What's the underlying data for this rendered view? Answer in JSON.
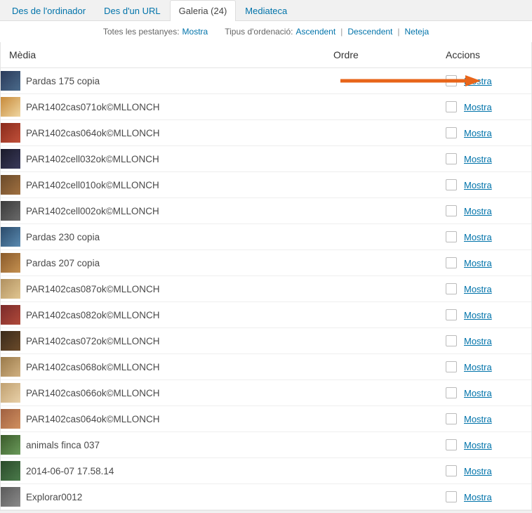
{
  "tabs": [
    {
      "label": "Des de l'ordinador",
      "active": false
    },
    {
      "label": "Des d'un URL",
      "active": false
    },
    {
      "label": "Galeria (24)",
      "active": true
    },
    {
      "label": "Mediateca",
      "active": false
    }
  ],
  "controls": {
    "all_tabs_label": "Totes les pestanyes:",
    "all_tabs_link": "Mostra",
    "sort_type_label": "Tipus d'ordenació:",
    "sort_asc": "Ascendent",
    "sort_desc": "Descendent",
    "sort_clear": "Neteja"
  },
  "columns": {
    "media": "Mèdia",
    "order": "Ordre",
    "actions": "Accions"
  },
  "action_link_label": "Mostra",
  "rows": [
    {
      "name": "Pardas 175 copia",
      "thumb": "t0",
      "highlight": true
    },
    {
      "name": "PAR1402cas071ok©MLLONCH",
      "thumb": "t1"
    },
    {
      "name": "PAR1402cas064ok©MLLONCH",
      "thumb": "t2"
    },
    {
      "name": "PAR1402cell032ok©MLLONCH",
      "thumb": "t3"
    },
    {
      "name": "PAR1402cell010ok©MLLONCH",
      "thumb": "t4"
    },
    {
      "name": "PAR1402cell002ok©MLLONCH",
      "thumb": "t5"
    },
    {
      "name": "Pardas 230 copia",
      "thumb": "t6"
    },
    {
      "name": "Pardas 207 copia",
      "thumb": "t7"
    },
    {
      "name": "PAR1402cas087ok©MLLONCH",
      "thumb": "t8"
    },
    {
      "name": "PAR1402cas082ok©MLLONCH",
      "thumb": "t9"
    },
    {
      "name": "PAR1402cas072ok©MLLONCH",
      "thumb": "t10"
    },
    {
      "name": "PAR1402cas068ok©MLLONCH",
      "thumb": "t11"
    },
    {
      "name": "PAR1402cas066ok©MLLONCH",
      "thumb": "t12"
    },
    {
      "name": "PAR1402cas064ok©MLLONCH",
      "thumb": "t13"
    },
    {
      "name": "animals finca 037",
      "thumb": "t14"
    },
    {
      "name": "2014-06-07 17.58.14",
      "thumb": "t15"
    },
    {
      "name": "Explorar0012",
      "thumb": "t16"
    }
  ]
}
